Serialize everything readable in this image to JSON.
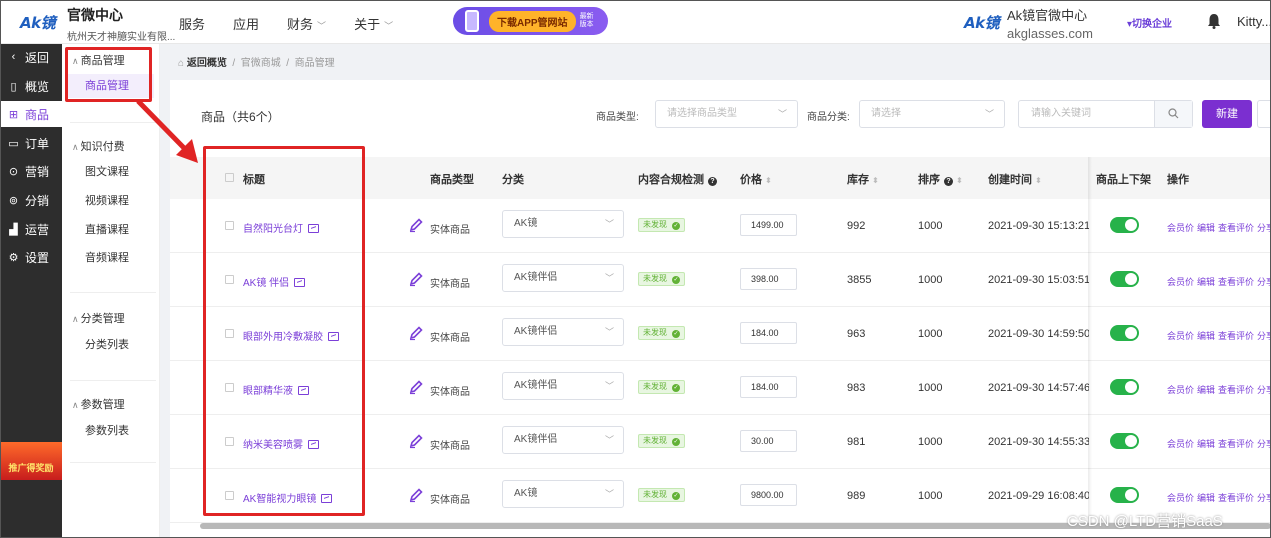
{
  "topbar": {
    "logo": "Ak镜",
    "org_title": "官微中心",
    "org_subtitle": "杭州天才神臆实业有限...",
    "nav": [
      "服务",
      "应用",
      "财务",
      "关于"
    ],
    "promo_label": "下载APP管网站",
    "promo_tag": "最新版本",
    "brand_logo": "Ak镜",
    "brand_title": "Ak镜官微中心",
    "brand_site": "akglasses.com",
    "switch_org": "▾切换企业",
    "user": "Kitty..."
  },
  "sidebar": {
    "items": [
      {
        "icon": "‹",
        "label": "返回"
      },
      {
        "icon": "▯",
        "label": "概览"
      },
      {
        "icon": "⊞",
        "label": "商品"
      },
      {
        "icon": "▭",
        "label": "订单"
      },
      {
        "icon": "⊙",
        "label": "营销"
      },
      {
        "icon": "⊚",
        "label": "分销"
      },
      {
        "icon": "▟",
        "label": "运营"
      },
      {
        "icon": "⚙",
        "label": "设置"
      }
    ],
    "badge": "推广得奖励"
  },
  "subsidebar": {
    "groups": {
      "goods": "商品管理",
      "knowledge": "知识付费",
      "category": "分类管理",
      "params": "参数管理"
    },
    "items": {
      "goods_manage": "商品管理",
      "graphic_course": "图文课程",
      "video_course": "视频课程",
      "live_course": "直播课程",
      "audio_course": "音频课程",
      "category_list": "分类列表",
      "param_list": "参数列表"
    }
  },
  "breadcrumb": {
    "home": "返回概览",
    "sep": "/",
    "level1": "官微商城",
    "level2": "商品管理"
  },
  "toolbar": {
    "title": "商品（共6个）",
    "type_label": "商品类型:",
    "type_placeholder": "请选择商品类型",
    "category_label": "商品分类:",
    "category_placeholder": "请选择",
    "search_placeholder": "请输入关键词",
    "new_label": "新建"
  },
  "table": {
    "headers": {
      "title": "标题",
      "type": "商品类型",
      "category": "分类",
      "compliance": "内容合规检测",
      "price": "价格",
      "stock": "库存",
      "sort": "排序",
      "created": "创建时间",
      "listed": "商品上下架",
      "ops": "操作"
    },
    "ops_labels": [
      "会员价",
      "编辑",
      "查看评价",
      "分享"
    ],
    "rows": [
      {
        "title": "自然阳光台灯",
        "type": "实体商品",
        "category": "AK镜",
        "status": "未发现",
        "price": "1499.00",
        "stock": "992",
        "sort": "1000",
        "created": "2021-09-30 15:13:21",
        "listed": true
      },
      {
        "title": "AK镜 伴侣",
        "type": "实体商品",
        "category": "AK镜伴侣",
        "status": "未发现",
        "price": "398.00",
        "stock": "3855",
        "sort": "1000",
        "created": "2021-09-30 15:03:51",
        "listed": true
      },
      {
        "title": "眼部外用冷敷凝胶",
        "type": "实体商品",
        "category": "AK镜伴侣",
        "status": "未发现",
        "price": "184.00",
        "stock": "963",
        "sort": "1000",
        "created": "2021-09-30 14:59:50",
        "listed": true
      },
      {
        "title": "眼部精华液",
        "type": "实体商品",
        "category": "AK镜伴侣",
        "status": "未发现",
        "price": "184.00",
        "stock": "983",
        "sort": "1000",
        "created": "2021-09-30 14:57:46",
        "listed": true
      },
      {
        "title": "纳米美容喷雾",
        "type": "实体商品",
        "category": "AK镜伴侣",
        "status": "未发现",
        "price": "30.00",
        "stock": "981",
        "sort": "1000",
        "created": "2021-09-30 14:55:33",
        "listed": true
      },
      {
        "title": "AK智能视力眼镜",
        "type": "实体商品",
        "category": "AK镜",
        "status": "未发现",
        "price": "9800.00",
        "stock": "989",
        "sort": "1000",
        "created": "2021-09-29 16:08:40",
        "listed": true
      }
    ]
  },
  "watermark": "CSDN @LTD营销SaaS",
  "colors": {
    "accent": "#7b2fd0",
    "success": "#27b24a",
    "annotation": "#e02424"
  },
  "icons": [
    "home-icon",
    "bell-icon",
    "search-icon",
    "pencil-icon",
    "image-icon",
    "question-icon",
    "sort-icon",
    "check-icon",
    "chevron-down-icon"
  ]
}
